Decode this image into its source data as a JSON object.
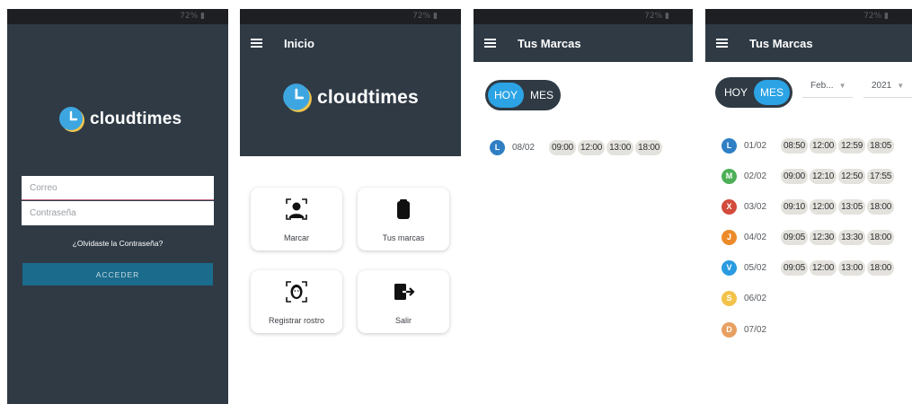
{
  "status": {
    "battery": "72% ▮"
  },
  "login": {
    "brand": "cloudtimes",
    "email_placeholder": "Correo",
    "password_placeholder": "Contraseña",
    "forgot_label": "¿Olvidaste la Contraseña?",
    "submit_label": "ACCEDER"
  },
  "home": {
    "title": "Inicio",
    "brand": "cloudtimes",
    "tiles": [
      {
        "label": "Marcar",
        "icon": "person-icon"
      },
      {
        "label": "Tus marcas",
        "icon": "clipboard-icon"
      },
      {
        "label": "Registrar rostro",
        "icon": "face-scan-icon"
      },
      {
        "label": "Salir",
        "icon": "exit-icon"
      }
    ]
  },
  "today": {
    "title": "Tus Marcas",
    "toggle": {
      "today": "HOY",
      "month": "MES",
      "selected": "HOY"
    },
    "days": [
      {
        "letter": "L",
        "date": "08/02",
        "color": "#2f7fc4",
        "times": [
          "09:00",
          "12:00",
          "13:00",
          "18:00"
        ]
      }
    ]
  },
  "month": {
    "title": "Tus Marcas",
    "toggle": {
      "today": "HOY",
      "month": "MES",
      "selected": "MES"
    },
    "month_select": "Feb...",
    "year_select": "2021",
    "days": [
      {
        "letter": "L",
        "date": "01/02",
        "color": "#2f7fc4",
        "times": [
          "08:50",
          "12:00",
          "12:59",
          "18:05"
        ]
      },
      {
        "letter": "M",
        "date": "02/02",
        "color": "#4daf56",
        "times": [
          "09:00",
          "12:10",
          "12:50",
          "17:55"
        ]
      },
      {
        "letter": "X",
        "date": "03/02",
        "color": "#d24b3c",
        "times": [
          "09:10",
          "12:00",
          "13:05",
          "18:00"
        ]
      },
      {
        "letter": "J",
        "date": "04/02",
        "color": "#ec8a2a",
        "times": [
          "09:05",
          "12:30",
          "13:30",
          "18:00"
        ]
      },
      {
        "letter": "V",
        "date": "05/02",
        "color": "#2a9be0",
        "times": [
          "09:05",
          "12:00",
          "13:00",
          "18:00"
        ]
      },
      {
        "letter": "S",
        "date": "06/02",
        "color": "#f2c24a",
        "times": []
      },
      {
        "letter": "D",
        "date": "07/02",
        "color": "#e8a062",
        "times": []
      }
    ]
  }
}
